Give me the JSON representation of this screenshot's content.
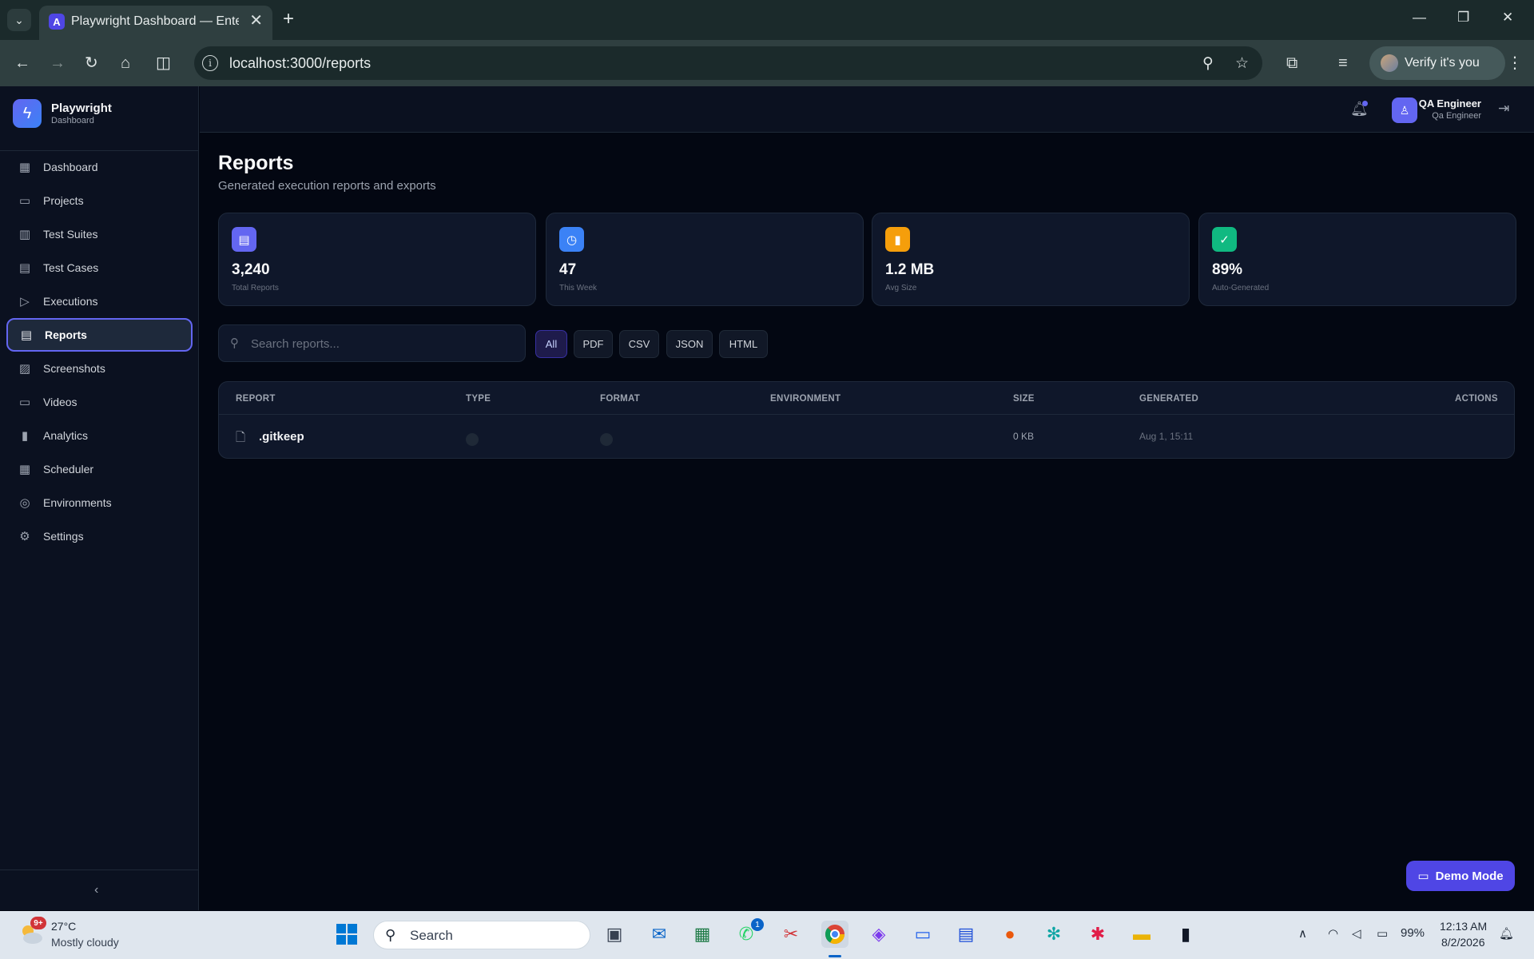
{
  "browser": {
    "tab_title": "Playwright Dashboard — Enterprise",
    "tab_favicon_letter": "A",
    "url": "localhost:3000/reports",
    "profile_label": "Verify it's you"
  },
  "brand": {
    "name": "Playwright",
    "subtitle": "Dashboard"
  },
  "nav": [
    {
      "label": "Dashboard",
      "icon": "dashboard-grid-icon"
    },
    {
      "label": "Projects",
      "icon": "folder-icon"
    },
    {
      "label": "Test Suites",
      "icon": "columns-icon"
    },
    {
      "label": "Test Cases",
      "icon": "document-icon"
    },
    {
      "label": "Executions",
      "icon": "play-icon"
    },
    {
      "label": "Reports",
      "icon": "clipboard-icon",
      "active": true
    },
    {
      "label": "Screenshots",
      "icon": "image-icon"
    },
    {
      "label": "Videos",
      "icon": "video-icon"
    },
    {
      "label": "Analytics",
      "icon": "bar-chart-icon"
    },
    {
      "label": "Scheduler",
      "icon": "calendar-icon"
    },
    {
      "label": "Environments",
      "icon": "globe-icon"
    },
    {
      "label": "Settings",
      "icon": "gear-icon"
    }
  ],
  "header": {
    "user_name": "QA Engineer",
    "user_role": "Qa Engineer"
  },
  "page": {
    "title": "Reports",
    "subtitle": "Generated execution reports and exports"
  },
  "stats": [
    {
      "value": "3,240",
      "label": "Total Reports",
      "color": "#6366f1",
      "icon": "document-icon"
    },
    {
      "value": "47",
      "label": "This Week",
      "color": "#3b82f6",
      "icon": "clock-icon"
    },
    {
      "value": "1.2 MB",
      "label": "Avg Size",
      "color": "#f59e0b",
      "icon": "bar-chart-icon"
    },
    {
      "value": "89%",
      "label": "Auto-Generated",
      "color": "#10b981",
      "icon": "check-circle-icon"
    }
  ],
  "search": {
    "placeholder": "Search reports..."
  },
  "filters": [
    "All",
    "PDF",
    "CSV",
    "JSON",
    "HTML"
  ],
  "table": {
    "columns": [
      "REPORT",
      "TYPE",
      "FORMAT",
      "ENVIRONMENT",
      "SIZE",
      "GENERATED",
      "ACTIONS"
    ],
    "rows": [
      {
        "name": ".gitkeep",
        "type": "",
        "format": "",
        "environment": "",
        "size": "0 KB",
        "generated": "Aug 1, 15:11"
      }
    ]
  },
  "demo_button": "Demo Mode",
  "taskbar": {
    "weather_temp": "27°C",
    "weather_desc": "Mostly cloudy",
    "weather_badge": "9+",
    "search_label": "Search",
    "whatsapp_badge": "1",
    "battery": "99%",
    "time": "12:13 AM",
    "date": "8/2/2026"
  }
}
